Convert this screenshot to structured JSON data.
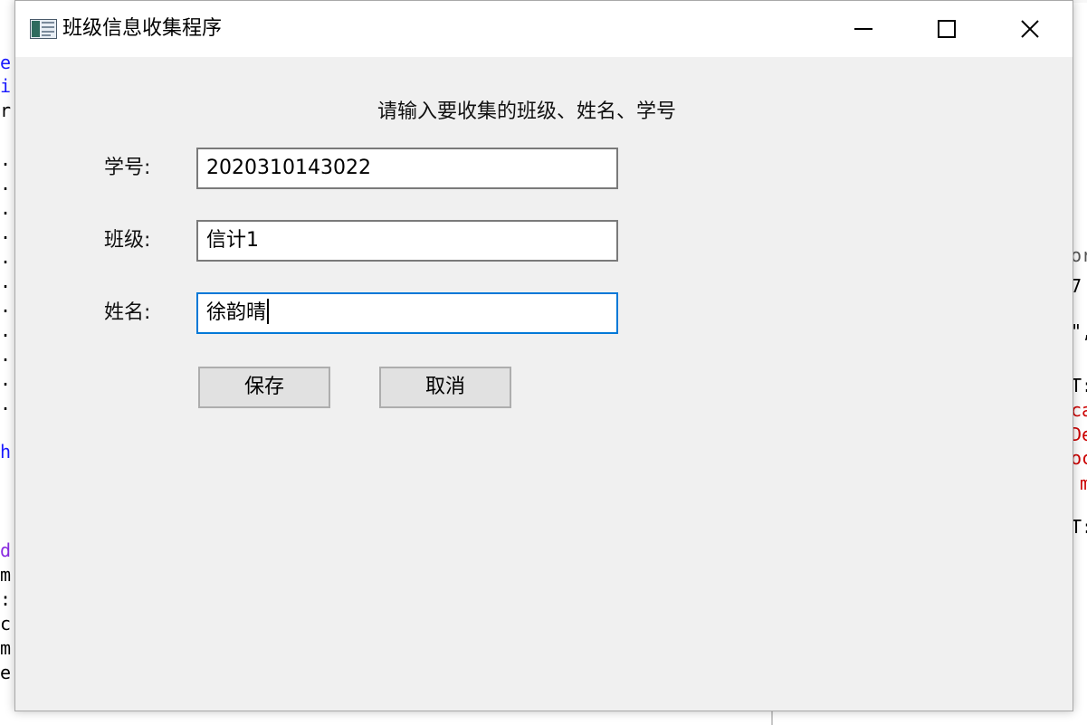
{
  "background": {
    "left_chars": [
      "e",
      "i",
      "r",
      ".",
      ".",
      ".",
      ".",
      ".",
      ".",
      ".",
      ".",
      ".",
      ".",
      ".",
      "h",
      "d",
      "m",
      ":",
      "c",
      "m",
      "e"
    ],
    "right_chars": [
      "or",
      "7",
      "\",",
      "T:",
      "ca",
      "De",
      "oc",
      "m",
      "T:"
    ]
  },
  "window": {
    "title": "班级信息收集程序",
    "icon": "app-form-icon",
    "controls": {
      "minimize_icon": "minimize-icon",
      "maximize_icon": "maximize-icon",
      "close_icon": "close-icon"
    }
  },
  "form": {
    "prompt": "请输入要收集的班级、姓名、学号",
    "student_id": {
      "label": "学号:",
      "value": "2020310143022"
    },
    "class": {
      "label": "班级:",
      "value": "信计1"
    },
    "name": {
      "label": "姓名:",
      "value": "徐韵晴"
    }
  },
  "buttons": {
    "save_label": "保存",
    "cancel_label": "取消"
  },
  "colors": {
    "focus_border": "#0078d7",
    "window_bg": "#f0f0f0",
    "button_bg": "#e1e1e1"
  }
}
